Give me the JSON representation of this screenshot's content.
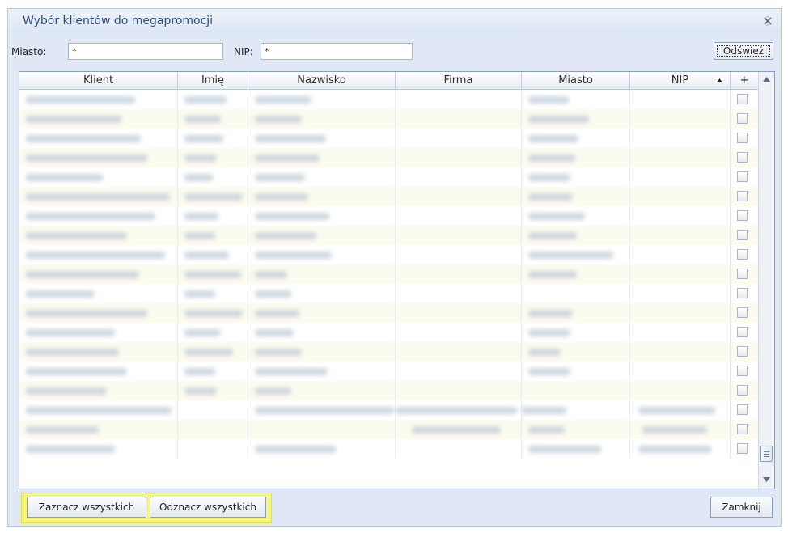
{
  "dialog": {
    "title": "Wybór klientów do megapromocji",
    "close_icon": "close-x-icon"
  },
  "filters": {
    "city_label": "Miasto:",
    "city_value": "*",
    "nip_label": "NIP:",
    "nip_value": "*",
    "refresh_label": "Odśwież"
  },
  "grid": {
    "columns": [
      "Klient",
      "Imię",
      "Nazwisko",
      "Firma",
      "Miasto",
      "NIP",
      "+"
    ],
    "sort_column": "NIP",
    "sort_direction": "ascending",
    "row_content": "blurred (unreadable)",
    "visible_rows": 19
  },
  "footer": {
    "select_all_label": "Zaznacz wszystkich",
    "deselect_all_label": "Odznacz wszystkich",
    "close_label": "Zamknij"
  },
  "colors": {
    "window_bg": "#dfe8f4",
    "title_text": "#2a4a7a",
    "highlight": "#f5f57a",
    "alt_row": "#fcfbef"
  }
}
